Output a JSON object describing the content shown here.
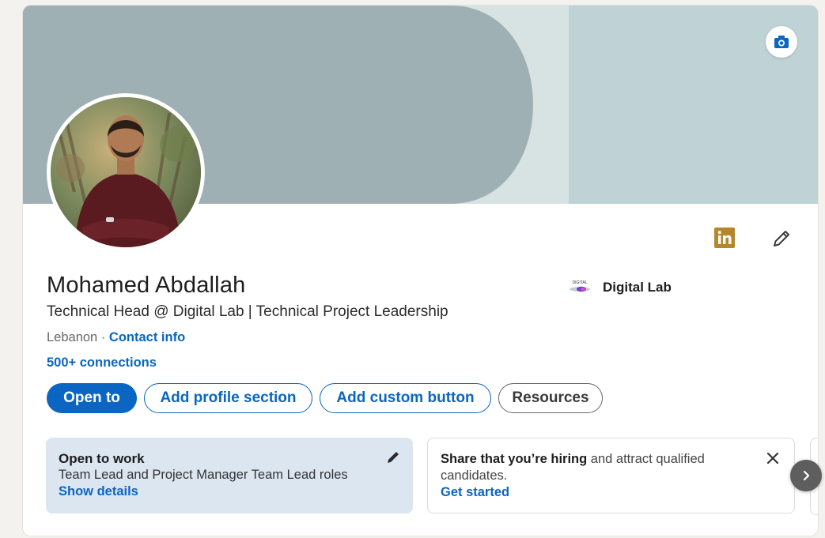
{
  "profile": {
    "name": "Mohamed Abdallah",
    "headline": "Technical Head @ Digital Lab | Technical Project Leadership",
    "location": "Lebanon",
    "separator": " · ",
    "contact_info_label": "Contact info",
    "connections": "500+ connections"
  },
  "company": {
    "name": "Digital Lab",
    "logo_text": "DIGITAL"
  },
  "actions": {
    "open_to": "Open to",
    "add_profile_section": "Add profile section",
    "add_custom_button": "Add custom button",
    "resources": "Resources"
  },
  "open_to_work": {
    "title": "Open to work",
    "roles": "Team Lead and Project Manager Team Lead roles",
    "link": "Show details"
  },
  "hiring": {
    "bold": "Share that you’re hiring",
    "rest": " and attract qualified candidates.",
    "link": "Get started"
  },
  "icons": {
    "camera": "camera-icon",
    "linkedin": "linkedin-badge-icon",
    "edit": "pencil-icon",
    "close": "close-icon",
    "next": "chevron-right-icon"
  },
  "colors": {
    "brand_blue": "#0a66c2",
    "banner_dark": "#9fb0b4",
    "banner_light": "#bfd2d6",
    "open_to_work_bg": "#dce6f1",
    "linkedin_badge": "#b5862a"
  }
}
